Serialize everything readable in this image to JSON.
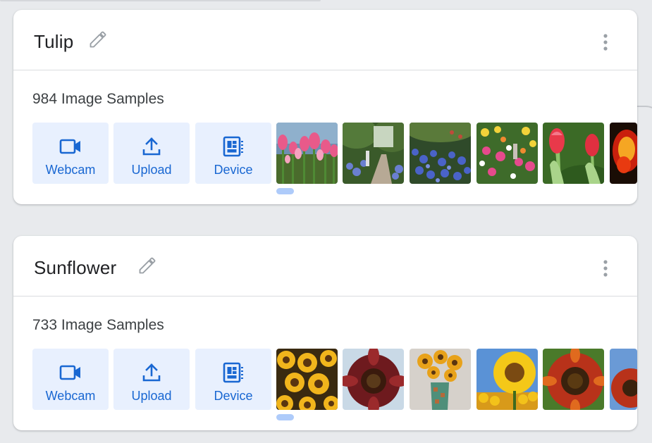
{
  "classes": [
    {
      "name": "Tulip",
      "samples_label": "984 Image Samples",
      "buttons": {
        "webcam": "Webcam",
        "upload": "Upload",
        "device": "Device"
      },
      "thumbnails": [
        "tulips-field",
        "garden-path",
        "blue-flowers",
        "flower-garden",
        "red-tulips",
        "orange-flower"
      ]
    },
    {
      "name": "Sunflower",
      "samples_label": "733 Image Samples",
      "buttons": {
        "webcam": "Webcam",
        "upload": "Upload",
        "device": "Device"
      },
      "thumbnails": [
        "sunflower-bunch",
        "dark-sunflower",
        "sunflowers-vase",
        "sunflower-sky",
        "red-sunflower",
        "sunflower-partial"
      ]
    }
  ],
  "icons": {
    "edit": "pencil-icon",
    "menu": "more-vert-icon",
    "webcam": "videocam-icon",
    "upload": "upload-icon",
    "device": "device-icon"
  },
  "colors": {
    "accent": "#1967d2",
    "button_bg": "#e8f0fe",
    "scroll_indicator": "#aecbfa",
    "background": "#e8eaed"
  }
}
